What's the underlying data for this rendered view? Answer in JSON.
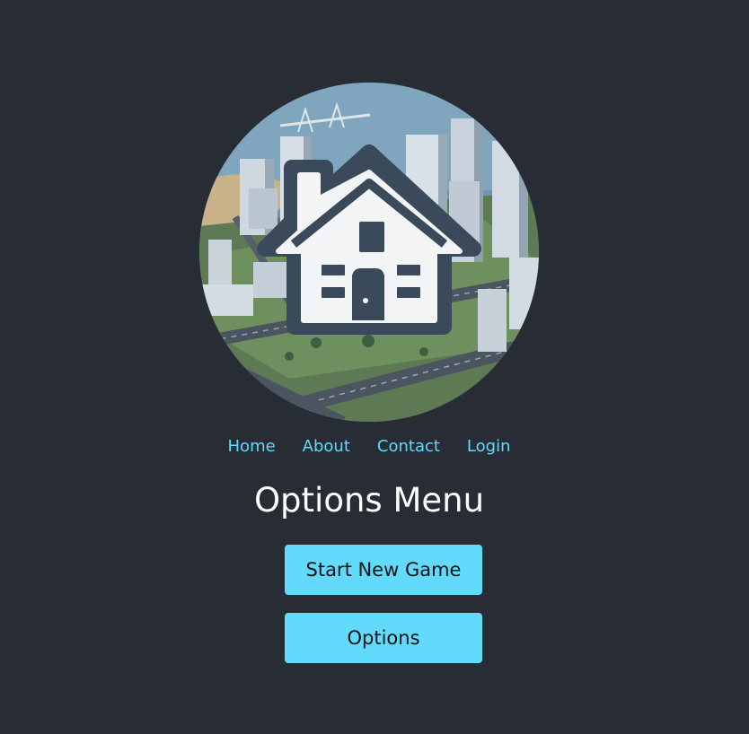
{
  "logo": {
    "alt": "City house logo"
  },
  "nav": {
    "items": [
      {
        "label": "Home"
      },
      {
        "label": "About"
      },
      {
        "label": "Contact"
      },
      {
        "label": "Login"
      }
    ]
  },
  "main": {
    "title": "Options Menu",
    "buttons": [
      {
        "label": "Start New Game"
      },
      {
        "label": "Options"
      }
    ]
  },
  "colors": {
    "background": "#282c34",
    "accent": "#61dafb",
    "title": "#ffffff"
  }
}
